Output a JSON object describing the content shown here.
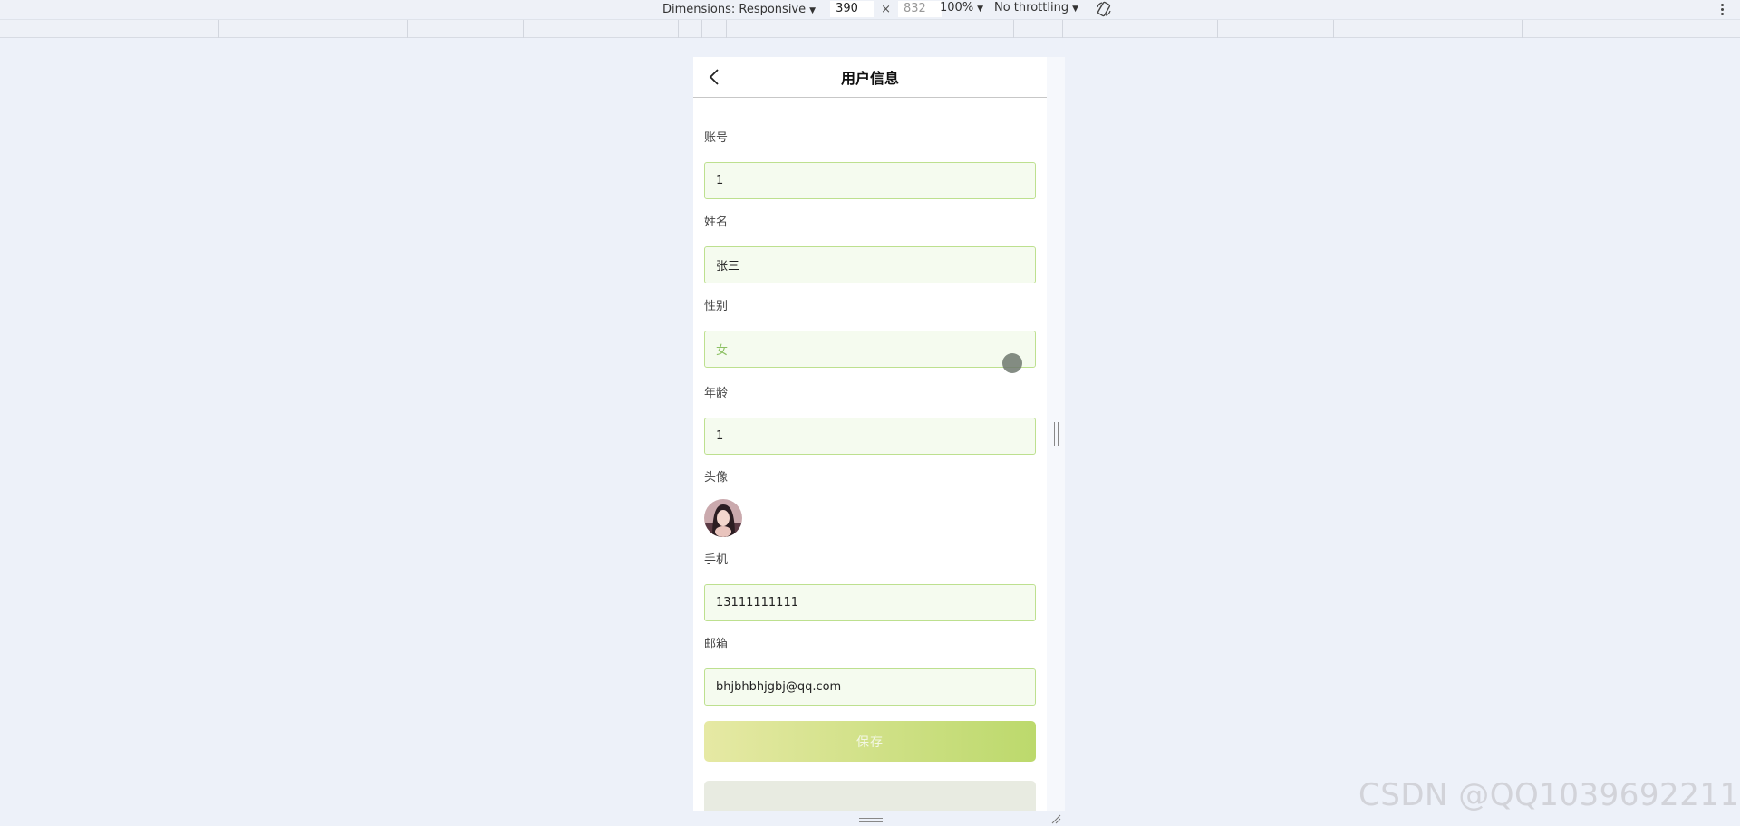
{
  "devtools": {
    "dimensions_label": "Dimensions: Responsive",
    "width_value": "390",
    "height_placeholder": "832",
    "times_sign": "×",
    "zoom": "100%",
    "throttling": "No throttling"
  },
  "page": {
    "title": "用户信息"
  },
  "form": {
    "account": {
      "label": "账号",
      "value": "1"
    },
    "name": {
      "label": "姓名",
      "value": "张三"
    },
    "gender": {
      "label": "性别",
      "value": "女"
    },
    "age": {
      "label": "年龄",
      "value": "1"
    },
    "avatar": {
      "label": "头像"
    },
    "phone": {
      "label": "手机",
      "value": "13111111111"
    },
    "email": {
      "label": "邮箱",
      "value": "bhjbhbhjgbj@qq.com"
    }
  },
  "buttons": {
    "save_label": "保存"
  },
  "colors": {
    "field_border": "#bde08f",
    "field_bg": "#f5fbef",
    "save_gradient_start": "#e6e9a4",
    "save_gradient_end": "#bcd96c"
  },
  "watermark": "CSDN @QQ1039692211"
}
